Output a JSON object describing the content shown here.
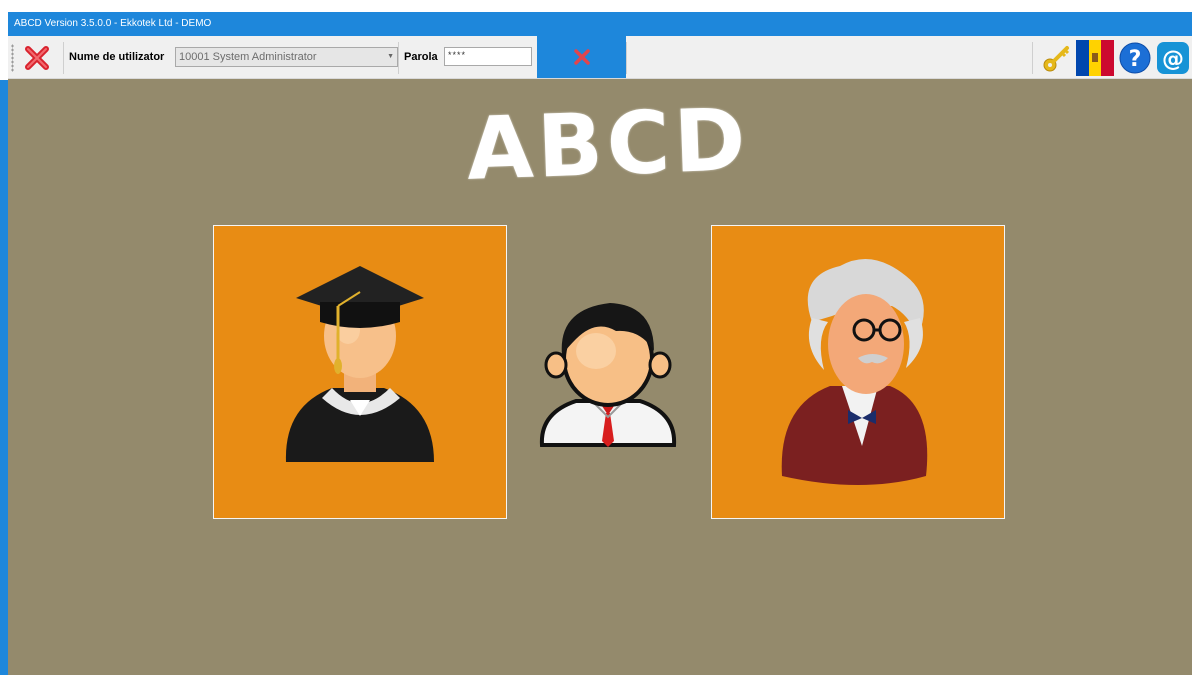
{
  "window": {
    "title": "ABCD Version 3.5.0.0 - Ekkotek Ltd - DEMO"
  },
  "toolbar": {
    "username_label": "Nume de utilizator",
    "username_value": "10001 System Administrator",
    "password_label": "Parola",
    "password_value": "****"
  },
  "main": {
    "logo_text": "ABCD"
  },
  "colors": {
    "accent": "#1e87db",
    "background": "#948a6c",
    "panel": "#e88c14"
  },
  "icons": [
    "close-icon",
    "cancel-icon",
    "key-icon",
    "flag-icon",
    "help-icon",
    "email-icon",
    "graduate-icon",
    "student-icon",
    "professor-icon"
  ]
}
